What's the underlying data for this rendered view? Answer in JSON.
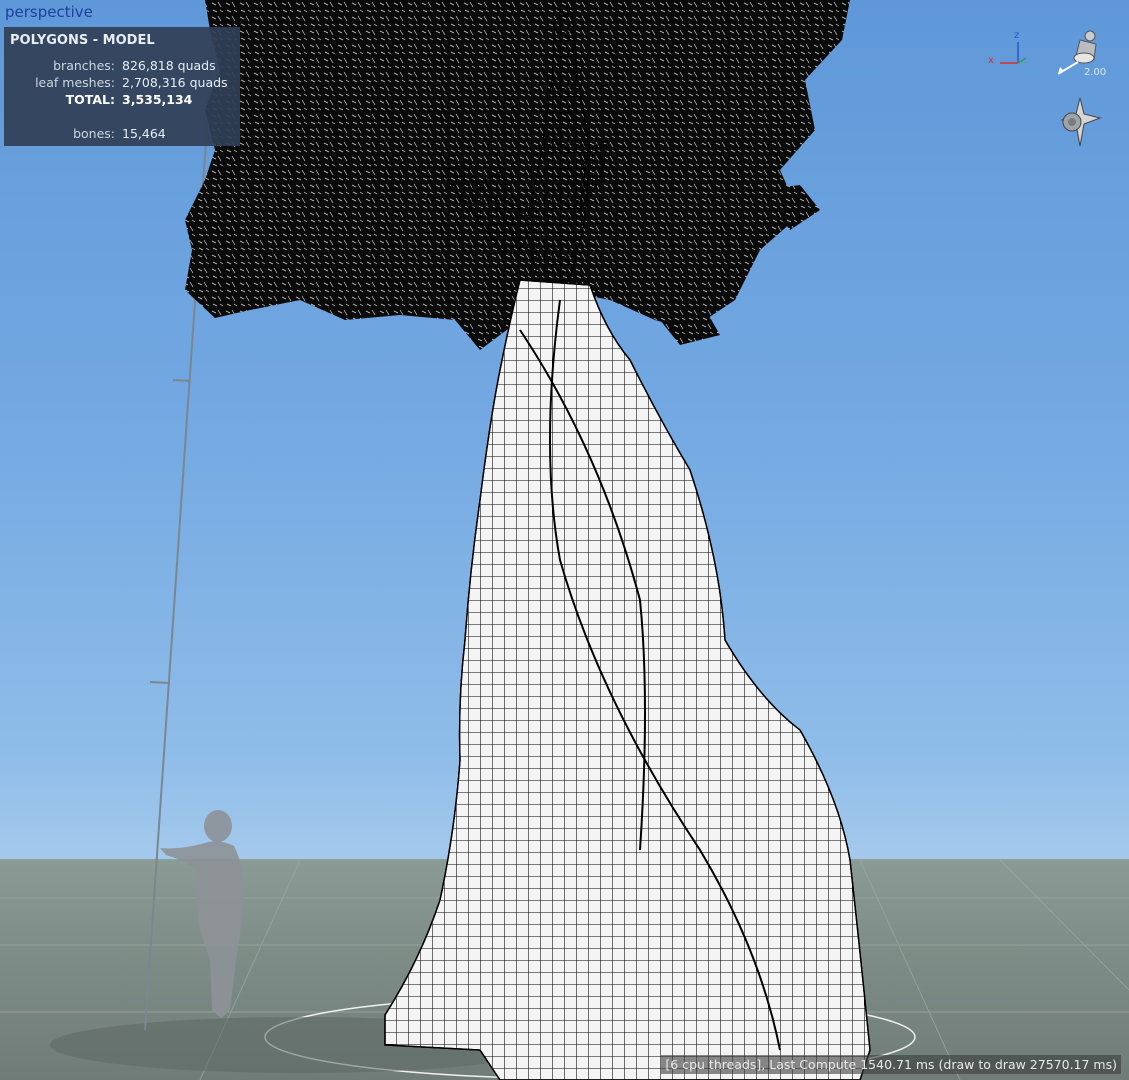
{
  "viewport": {
    "label": "perspective"
  },
  "stats": {
    "title": "POLYGONS - MODEL",
    "rows": [
      {
        "key": "branches:",
        "value": "826,818 quads"
      },
      {
        "key": "leaf meshes:",
        "value": "2,708,316 quads"
      },
      {
        "key": "TOTAL:",
        "value": "3,535,134"
      },
      {
        "key": "bones:",
        "value": "15,464"
      }
    ]
  },
  "gizmo": {
    "x_label": "x",
    "z_label": "z",
    "icon": "axis-gizmo-icon"
  },
  "light": {
    "value": "2.00",
    "icon": "light-icon"
  },
  "camera": {
    "icon": "camera-orientation-icon"
  },
  "status": {
    "text": "[6 cpu threads], Last Compute 1540.71 ms (draw to draw 27570.17 ms)"
  },
  "colors": {
    "sky_top": "#5f98d9",
    "sky_bottom": "#a4c9ec",
    "ground": "#7f8d88",
    "panel": "#304056",
    "foliage": "#0a0a0a",
    "trunk": "#f4f4f4"
  }
}
